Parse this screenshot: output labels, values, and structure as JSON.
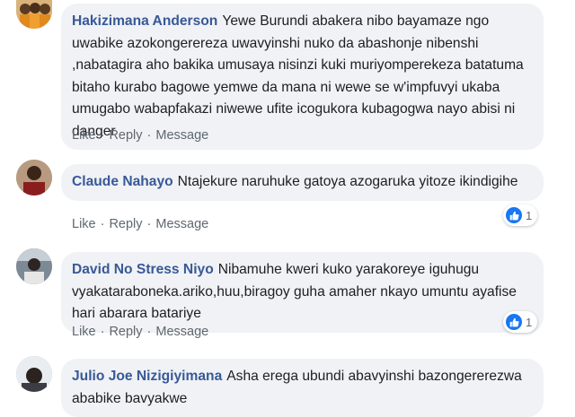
{
  "comments": [
    {
      "author": "Hakizimana Anderson",
      "text": "Yewe Burundi abakera nibo bayamaze ngo uwabike azokongerereza uwavyinshi nuko da abashonje nibenshi ,nabatagira aho bakika umusaya nisinzi kuki muriyomperekeza batatuma bitaho kurabo bagowe yemwe da mana ni wewe se w'impfuvyi ukaba umugabo wabapfakazi niwewe ufite icogukora kubagogwa nayo abisi ni danger",
      "actions": [
        "Like",
        "Reply",
        "Message"
      ]
    },
    {
      "author": "Claude Nahayo",
      "text": "Ntajekure naruhuke gatoya azogaruka yitoze ikindigihe",
      "actions": [
        "Like",
        "Reply",
        "Message"
      ],
      "reactions": {
        "icon": "like-icon",
        "count": "1"
      }
    },
    {
      "author": "David No Stress Niyo",
      "text": "Nibamuhe kweri kuko yarakoreye iguhugu vyakataraboneka.ariko,huu,biragoy guha amaher nkayo umuntu ayafise hari abarara batariye",
      "actions": [
        "Like",
        "Reply",
        "Message"
      ],
      "reactions": {
        "icon": "like-icon",
        "count": "1"
      }
    },
    {
      "author": "Julio Joe Nizigiyimana",
      "text": "Asha erega ubundi abavyinshi bazongererezwa ababike bavyakwe"
    }
  ],
  "colors": {
    "author": "#385898",
    "bubble": "#f0f2f5",
    "like": "#1877f2"
  }
}
